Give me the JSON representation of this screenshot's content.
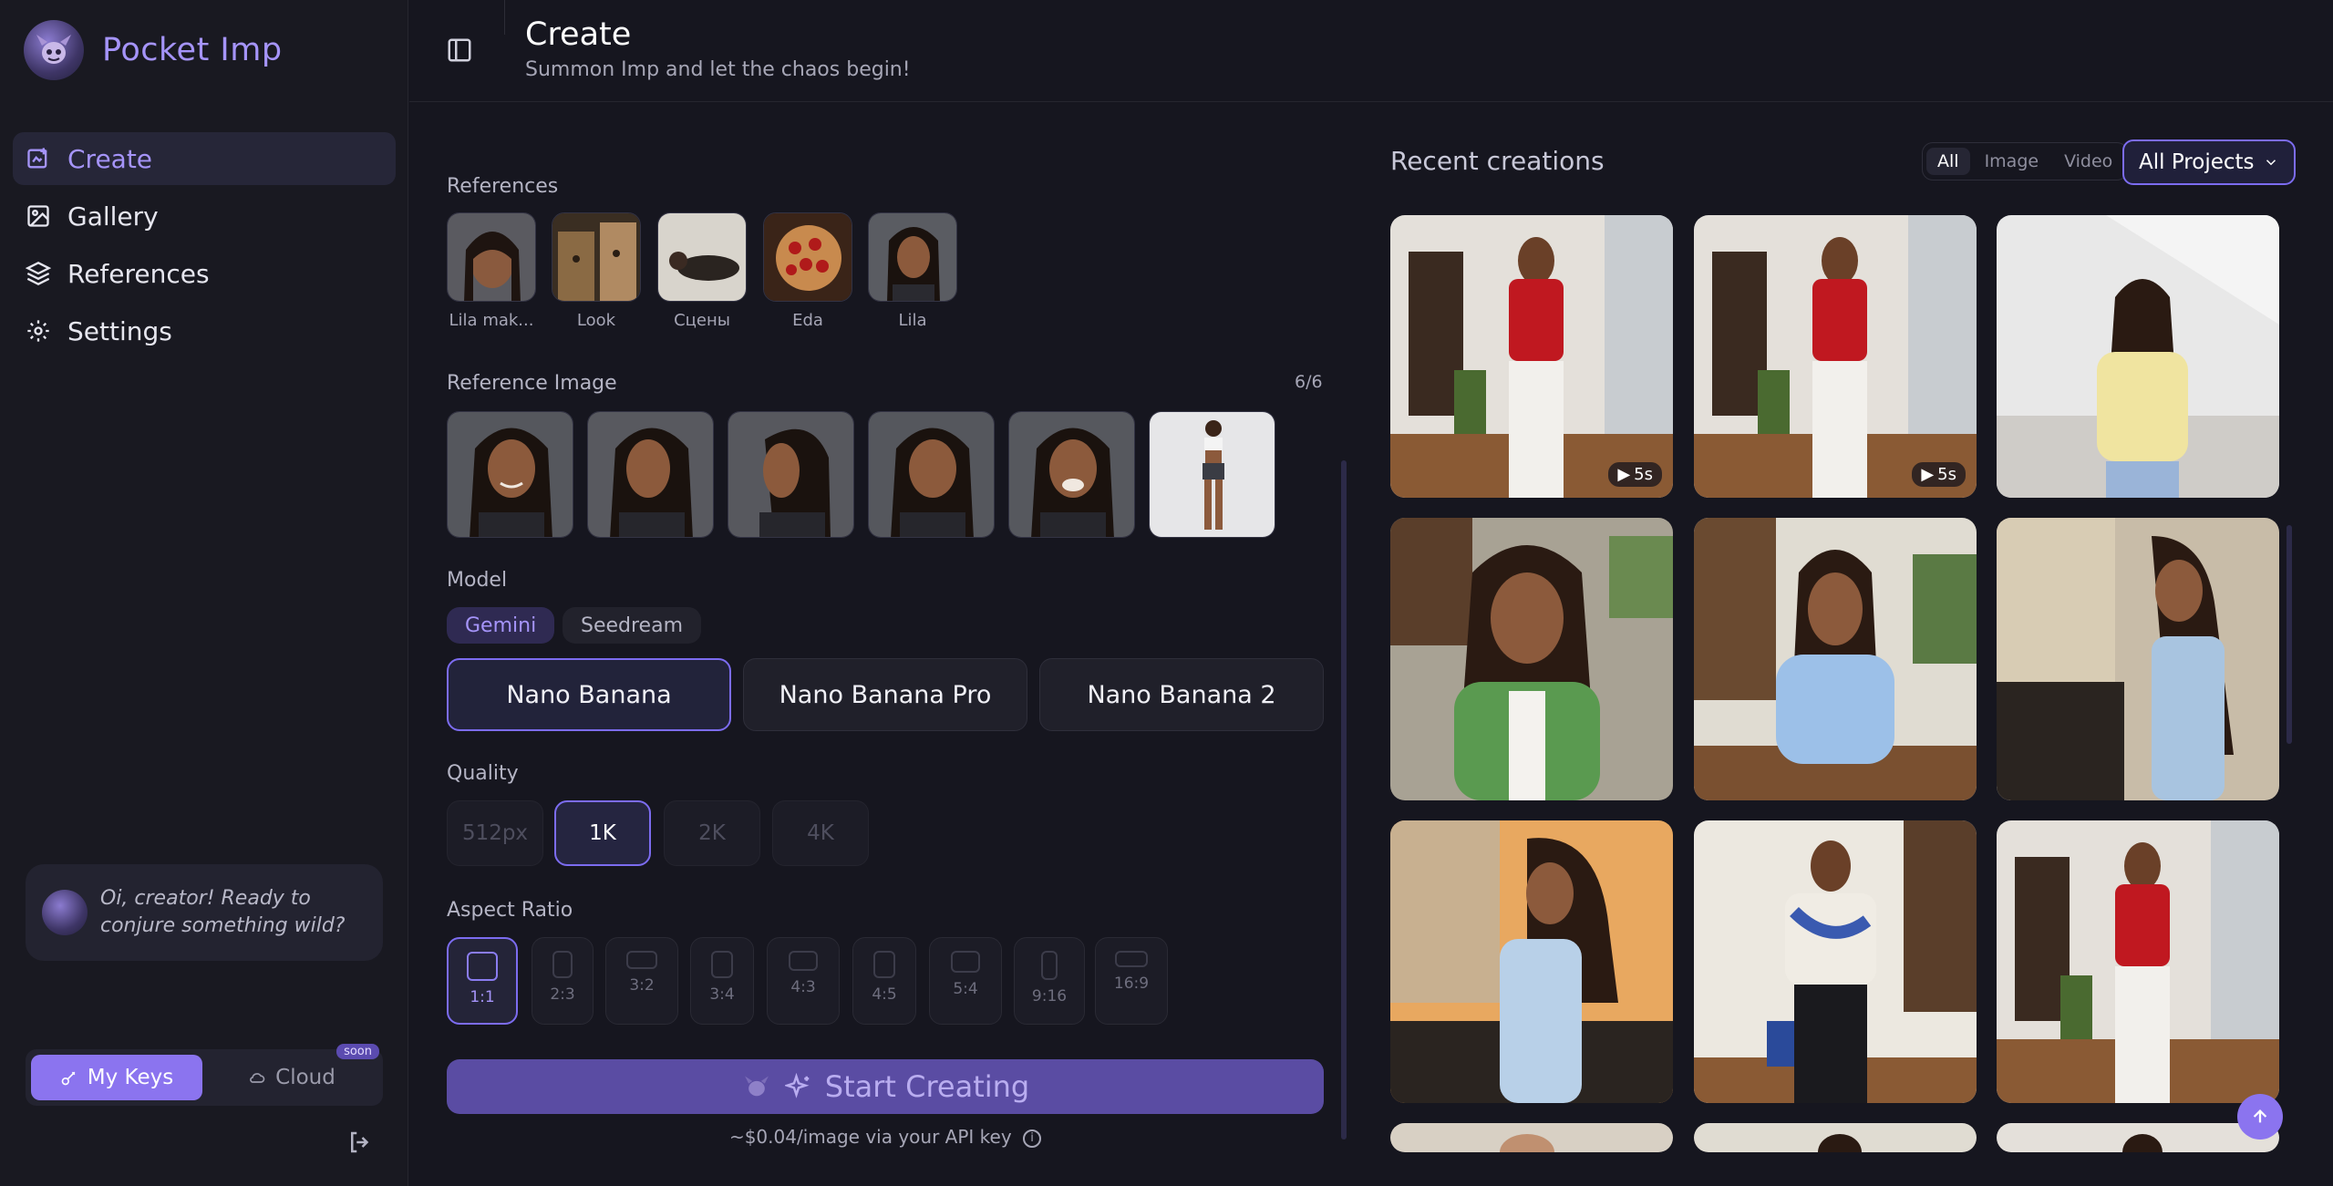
{
  "app": {
    "name": "Pocket Imp"
  },
  "nav": [
    {
      "label": "Create",
      "icon": "create-icon",
      "active": true
    },
    {
      "label": "Gallery",
      "icon": "gallery-icon",
      "active": false
    },
    {
      "label": "References",
      "icon": "layers-icon",
      "active": false
    },
    {
      "label": "Settings",
      "icon": "gear-icon",
      "active": false
    }
  ],
  "bubble": {
    "text": "Oi, creator! Ready to conjure something wild?"
  },
  "keys": {
    "my_keys": "My Keys",
    "cloud": "Cloud",
    "soon": "soon"
  },
  "header": {
    "title": "Create",
    "subtitle": "Summon Imp and let the chaos begin!"
  },
  "references": {
    "label": "References",
    "items": [
      "Lila mak...",
      "Look",
      "Сцены",
      "Eda",
      "Lila"
    ]
  },
  "reference_image": {
    "label": "Reference Image",
    "counter": "6/6"
  },
  "model": {
    "label": "Model",
    "providers": [
      "Gemini",
      "Seedream"
    ],
    "options": [
      "Nano Banana",
      "Nano Banana Pro",
      "Nano Banana 2"
    ],
    "selected": "Nano Banana"
  },
  "quality": {
    "label": "Quality",
    "options": [
      "512px",
      "1K",
      "2K",
      "4K"
    ],
    "selected": "1K"
  },
  "aspect_ratio": {
    "label": "Aspect Ratio",
    "options": [
      "1:1",
      "2:3",
      "3:2",
      "3:4",
      "4:3",
      "4:5",
      "5:4",
      "9:16",
      "16:9"
    ],
    "selected": "1:1"
  },
  "start": {
    "label": "Start Creating"
  },
  "cost": {
    "text": "~$0.04/image via your API key"
  },
  "recent": {
    "title": "Recent creations",
    "filters": [
      "All",
      "Image",
      "Video"
    ],
    "active_filter": "All",
    "project_select": "All Projects",
    "badges": [
      "5s",
      "5s"
    ]
  },
  "colors": {
    "accent": "#8b74ef",
    "brand": "#a594f9",
    "bg": "#16161f",
    "sidebar": "#191921"
  }
}
